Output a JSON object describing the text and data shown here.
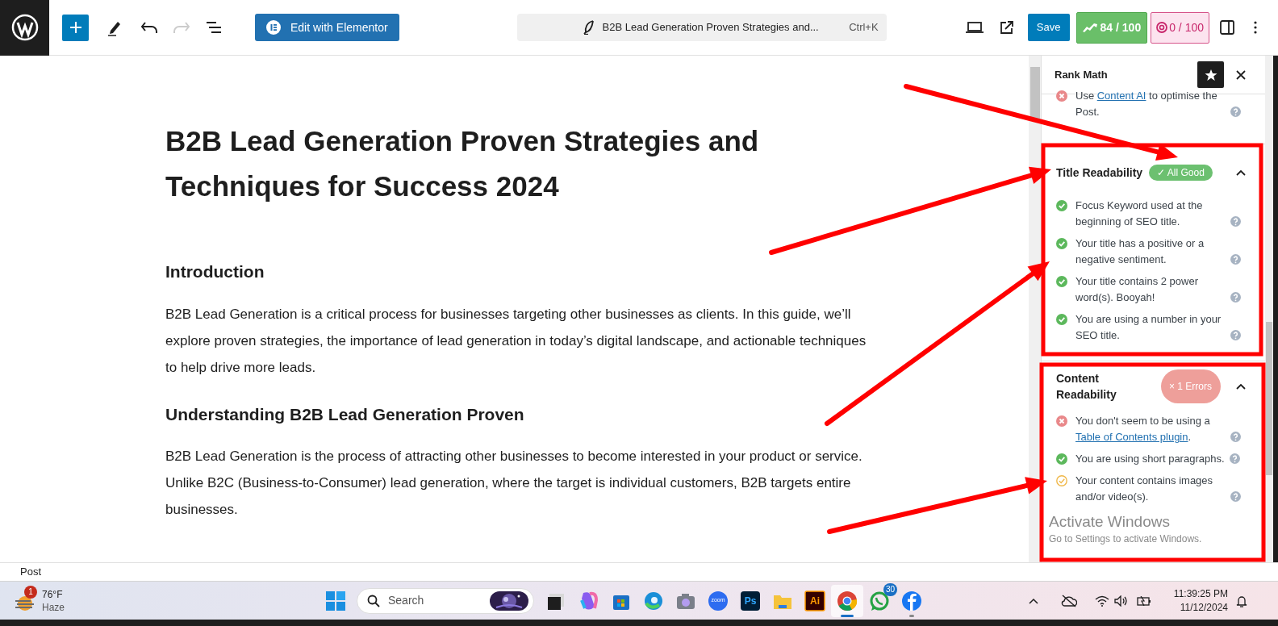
{
  "toolbar": {
    "elementor_button": "Edit with Elementor",
    "document_title": "B2B Lead Generation Proven Strategies and...",
    "shortcut": "Ctrl+K",
    "save": "Save",
    "seo_score": "84 / 100",
    "readability_score": "0 / 100"
  },
  "post": {
    "title": "B2B Lead Generation Proven Strategies and Techniques for Success 2024",
    "blocks": [
      {
        "kind": "heading",
        "text": "Introduction"
      },
      {
        "kind": "paragraph",
        "text": "B2B Lead Generation is a critical process for businesses targeting other businesses as clients. In this guide, we’ll explore proven strategies, the importance of lead generation in today’s digital landscape, and actionable techniques to help drive more leads."
      },
      {
        "kind": "heading",
        "text": "Understanding B2B Lead Generation Proven"
      },
      {
        "kind": "paragraph",
        "text": "B2B Lead Generation is the process of attracting other businesses to become interested in your product or service. Unlike B2C (Business-to-Consumer) lead generation, where the target is individual customers, B2B targets entire businesses."
      }
    ]
  },
  "sidebar": {
    "title": "Rank Math",
    "top_item": {
      "kind": "error",
      "before": "Use ",
      "link": "Content AI",
      "after": " to optimise the Post."
    },
    "panels": [
      {
        "title": "Title Readability",
        "badge": {
          "kind": "good",
          "icon": "✓",
          "text": "All Good"
        },
        "expanded": true,
        "items": [
          {
            "kind": "good",
            "before": "Focus Keyword used at the beginning of SEO title."
          },
          {
            "kind": "good",
            "before": "Your title has a positive or a negative sentiment."
          },
          {
            "kind": "good",
            "before": "Your title contains 2 power word(s). Booyah!"
          },
          {
            "kind": "good",
            "before": "You are using a number in your SEO title."
          }
        ]
      },
      {
        "title": "Content Readability",
        "badge": {
          "kind": "error",
          "icon": "×",
          "text": "1 Errors"
        },
        "expanded": true,
        "items": [
          {
            "kind": "error",
            "before": "You don't seem to be using a ",
            "link": "Table of Contents plugin",
            "after": "."
          },
          {
            "kind": "good",
            "before": "You are using short paragraphs."
          },
          {
            "kind": "warning",
            "before": "Your content contains images and/or video(s)."
          }
        ]
      }
    ]
  },
  "status_bar": "Post",
  "activation_notice": {
    "title": "Activate Windows",
    "subtitle": "Go to Settings to activate Windows."
  },
  "taskbar": {
    "weather": {
      "badge": "1",
      "temperature": "76°F",
      "condition": "Haze"
    },
    "search": {
      "placeholder": "Search"
    },
    "apps": [
      {
        "kind": "taskview",
        "selected": false,
        "running": false
      },
      {
        "kind": "copilot",
        "selected": false,
        "running": false
      },
      {
        "kind": "store",
        "selected": false,
        "running": false
      },
      {
        "kind": "edge",
        "selected": false,
        "running": false
      },
      {
        "kind": "camera",
        "selected": false,
        "running": false
      },
      {
        "kind": "zoom",
        "label": "zoom",
        "selected": false,
        "running": false
      },
      {
        "kind": "photoshop",
        "label": "Ps",
        "selected": false,
        "running": false
      },
      {
        "kind": "folder",
        "selected": false,
        "running": false
      },
      {
        "kind": "illustrator",
        "label": "Ai",
        "selected": false,
        "running": false
      },
      {
        "kind": "chrome",
        "selected": true,
        "running": true
      },
      {
        "kind": "whatsapp",
        "badge": "30",
        "selected": false,
        "running": false
      },
      {
        "kind": "facebook",
        "selected": false,
        "running": true
      }
    ],
    "time": "11:39:25 PM",
    "date": "11/12/2024"
  }
}
